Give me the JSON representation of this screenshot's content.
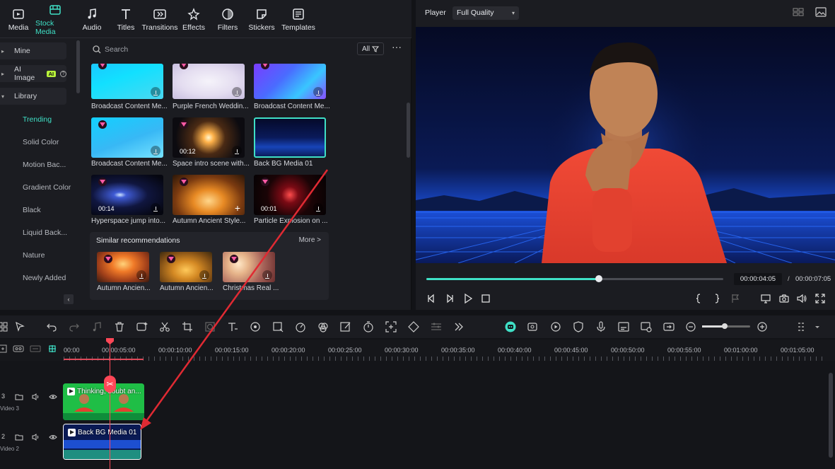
{
  "toolbar": {
    "tabs": [
      {
        "label": "Media",
        "icon": "media-icon"
      },
      {
        "label": "Stock Media",
        "icon": "stock-media-icon"
      },
      {
        "label": "Audio",
        "icon": "audio-icon"
      },
      {
        "label": "Titles",
        "icon": "titles-icon"
      },
      {
        "label": "Transitions",
        "icon": "transitions-icon"
      },
      {
        "label": "Effects",
        "icon": "effects-icon"
      },
      {
        "label": "Filters",
        "icon": "filters-icon"
      },
      {
        "label": "Stickers",
        "icon": "stickers-icon"
      },
      {
        "label": "Templates",
        "icon": "templates-icon"
      }
    ],
    "active_tab": "Stock Media"
  },
  "sidebar": {
    "mine": "Mine",
    "ai_image": "AI Image",
    "ai_badge": "AI",
    "library": "Library",
    "items": [
      "Trending",
      "Solid Color",
      "Motion Bac...",
      "Gradient Color",
      "Black",
      "Liquid Back...",
      "Nature",
      "Newly Added"
    ],
    "active_item": "Trending",
    "collapse_glyph": "‹"
  },
  "search": {
    "placeholder": "Search",
    "filter_label": "All",
    "more_glyph": "···"
  },
  "grid": {
    "items": [
      {
        "label": "Broadcast Content Me...",
        "duration": "",
        "premium": true
      },
      {
        "label": "Purple French Weddin...",
        "duration": "",
        "premium": true
      },
      {
        "label": "Broadcast Content Me...",
        "duration": "",
        "premium": true
      },
      {
        "label": "Broadcast Content Me...",
        "duration": "",
        "premium": true
      },
      {
        "label": "Space intro scene with...",
        "duration": "00:12",
        "premium": true
      },
      {
        "label": "Back BG Media 01",
        "duration": "",
        "premium": false,
        "selected": true
      },
      {
        "label": "Hyperspace jump into...",
        "duration": "00:14",
        "premium": true
      },
      {
        "label": "Autumn Ancient Style...",
        "duration": "",
        "premium": true
      },
      {
        "label": "Particle Explosion on ...",
        "duration": "00:01",
        "premium": true
      }
    ]
  },
  "similar": {
    "title": "Similar recommendations",
    "more": "More >",
    "items": [
      {
        "label": "Autumn Ancien..."
      },
      {
        "label": "Autumn Ancien..."
      },
      {
        "label": "Christmas Real ..."
      }
    ]
  },
  "player": {
    "label": "Player",
    "quality": "Full Quality",
    "time_current": "00:00:04:05",
    "time_separator": "/",
    "time_total": "00:00:07:05",
    "progress": 0.58
  },
  "timeline": {
    "ticks": [
      "00:00",
      "00:00:05:00",
      "00:00:10:00",
      "00:00:15:00",
      "00:00:20:00",
      "00:00:25:00",
      "00:00:30:00",
      "00:00:35:00",
      "00:00:40:00",
      "00:00:45:00",
      "00:00:50:00",
      "00:00:55:00",
      "00:01:00:00",
      "00:01:05:00"
    ],
    "tracks": [
      {
        "num": "3",
        "name": "Video 3"
      },
      {
        "num": "2",
        "name": "Video 2"
      }
    ],
    "clips": [
      {
        "title": "Thinking, doubt an..."
      },
      {
        "title": "Back BG Media 01"
      }
    ],
    "zoom": 0.47
  },
  "colors": {
    "accent": "#3fe0c6",
    "playhead": "#ff4757",
    "annotation": "#e02a33"
  }
}
